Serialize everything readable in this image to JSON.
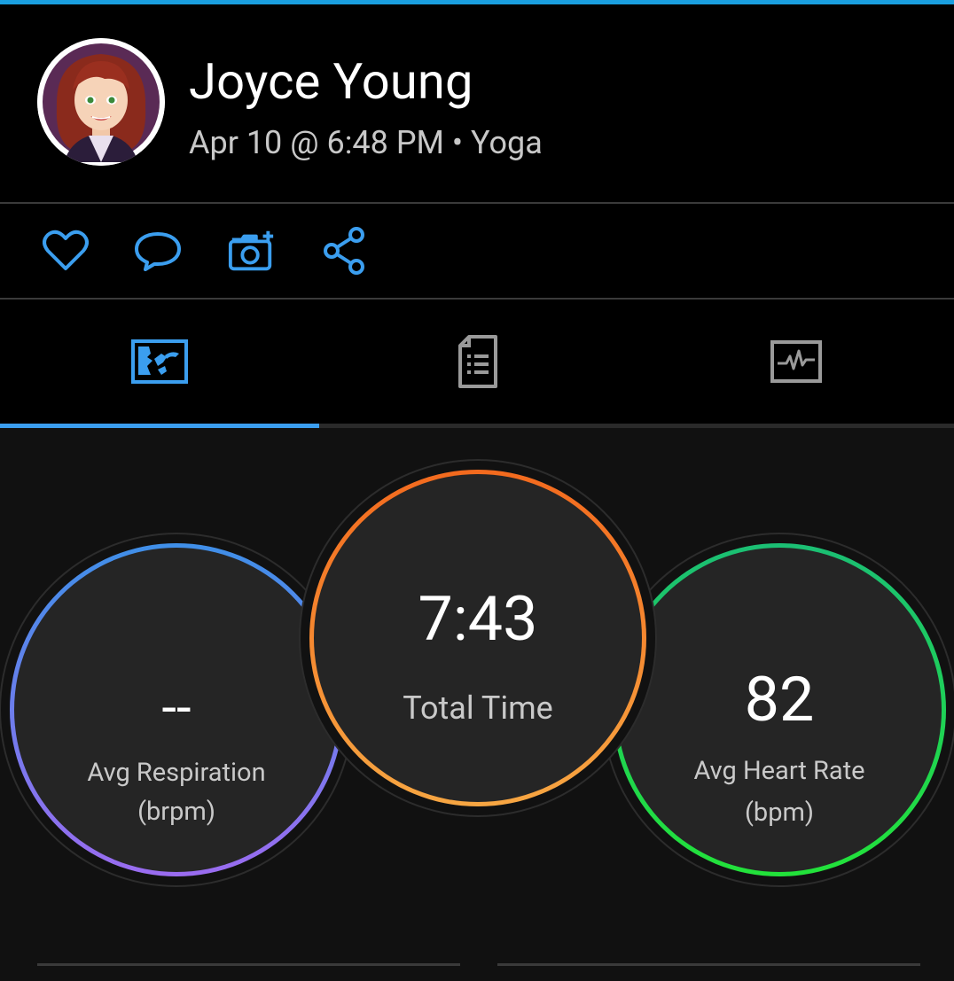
{
  "header": {
    "user_name": "Joyce Young",
    "subtitle": "Apr 10 @ 6:48 PM • Yoga",
    "accent_color": "#1a9fe0"
  },
  "actions": [
    {
      "icon": "heart-icon",
      "label": "Like"
    },
    {
      "icon": "comment-icon",
      "label": "Comment"
    },
    {
      "icon": "add-photo-icon",
      "label": "Add photo"
    },
    {
      "icon": "share-icon",
      "label": "Share"
    }
  ],
  "tabs": [
    {
      "icon": "overview-map-icon",
      "active": true
    },
    {
      "icon": "details-document-icon",
      "active": false
    },
    {
      "icon": "charts-pulse-icon",
      "active": false
    }
  ],
  "stats": {
    "left": {
      "value": "--",
      "label_1": "Avg Respiration",
      "label_2": "(brpm)",
      "ring_colors": [
        "#3f8fe8",
        "#9a6cf0"
      ]
    },
    "center": {
      "value": "7:43",
      "label_1": "Total Time",
      "ring_colors": [
        "#f36a1e",
        "#f7a642"
      ]
    },
    "right": {
      "value": "82",
      "label_1": "Avg Heart Rate",
      "label_2": "(bpm)",
      "ring_colors": [
        "#1bbf74",
        "#22e23a"
      ]
    }
  },
  "colors": {
    "icon_blue": "#3b9eef",
    "tab_inactive": "#9a9a9a"
  }
}
